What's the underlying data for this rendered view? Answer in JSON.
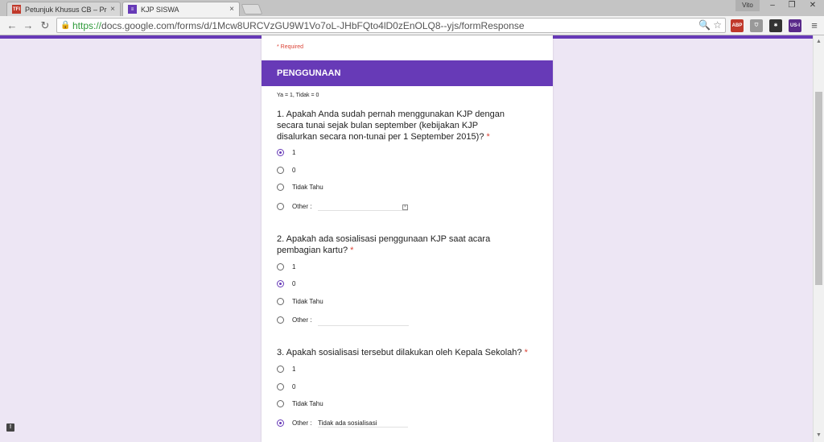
{
  "browser": {
    "tabs": [
      {
        "title": "Petunjuk Khusus CB – Prof",
        "favicon": "TFI",
        "close": "×"
      },
      {
        "title": "KJP SISWA",
        "favicon": "≡",
        "close": "×"
      }
    ],
    "profile_name": "Vito",
    "window_controls": {
      "minimize": "–",
      "restore": "❐",
      "close": "✕"
    },
    "nav": {
      "back": "←",
      "forward": "→",
      "reload": "↻"
    },
    "url_scheme": "https://",
    "url_rest": "docs.google.com/forms/d/1Mcw8URCVzGU9W1Vo7oL-JHbFQto4lD0zEnOLQ8--yjs/formResponse",
    "omni_icons": "🔍 ☆",
    "extensions": [
      {
        "name": "adblock-plus-icon",
        "label": "ABP",
        "color": "#c0392b"
      },
      {
        "name": "shield-icon",
        "label": "⛉",
        "color": "#999999"
      },
      {
        "name": "puzzle-icon",
        "label": "✱",
        "color": "#333333"
      },
      {
        "name": "us-i-extension-icon",
        "label": "US-I",
        "color": "#5a2a8a"
      }
    ],
    "menu": "≡"
  },
  "form": {
    "required_note": "* Required",
    "section_title": "PENGGUNAAN",
    "section_description": "Ya = 1, Tidak  = 0",
    "accent_color": "#673ab7",
    "questions": [
      {
        "text": "1. Apakah Anda sudah pernah menggunakan KJP dengan secara tunai sejak bulan september (kebijakan KJP disalurkan secara non-tunai per 1 September 2015)?",
        "star": "*",
        "options": [
          {
            "label": "1",
            "checked": true
          },
          {
            "label": "0",
            "checked": false
          },
          {
            "label": "Tidak Tahu",
            "checked": false
          },
          {
            "label": "Other :",
            "checked": false,
            "other_value": ""
          }
        ]
      },
      {
        "text": "2. Apakah ada sosialisasi penggunaan KJP saat acara pembagian kartu?",
        "star": "*",
        "options": [
          {
            "label": "1",
            "checked": false
          },
          {
            "label": "0",
            "checked": true
          },
          {
            "label": "Tidak Tahu",
            "checked": false
          },
          {
            "label": "Other :",
            "checked": false,
            "other_value": ""
          }
        ]
      },
      {
        "text": "3. Apakah sosialisasi tersebut dilakukan oleh Kepala Sekolah?",
        "star": "*",
        "options": [
          {
            "label": "1",
            "checked": false
          },
          {
            "label": "0",
            "checked": false
          },
          {
            "label": "Tidak Tahu",
            "checked": false
          },
          {
            "label": "Other :",
            "checked": true,
            "other_value": "Tidak ada sosialisasi"
          }
        ]
      }
    ]
  }
}
